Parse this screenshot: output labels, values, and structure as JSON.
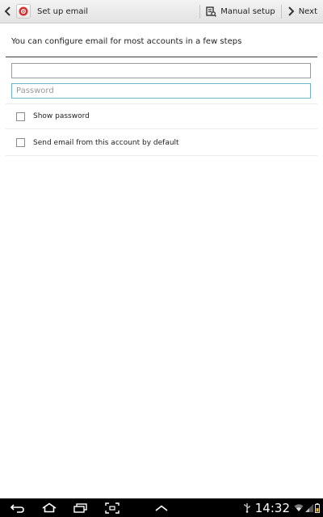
{
  "action_bar": {
    "title": "Set up email",
    "manual_setup_label": "Manual setup",
    "next_label": "Next",
    "icons": {
      "back": "chevron-left-icon",
      "app": "email-app-icon",
      "manual_setup": "manual-setup-icon",
      "next": "chevron-right-icon"
    }
  },
  "form": {
    "intro": "You can configure email for most accounts in a few steps",
    "email": {
      "value": "",
      "placeholder": ""
    },
    "password": {
      "value": "",
      "placeholder": "Password"
    },
    "options": [
      {
        "label": "Show password",
        "checked": false
      },
      {
        "label": "Send email from this account by default",
        "checked": false
      }
    ]
  },
  "system_bar": {
    "time": "14:32",
    "nav_icons": [
      "back-icon",
      "home-icon",
      "recent-apps-icon",
      "screenshot-icon",
      "menu-up-icon"
    ],
    "status_icons": [
      "usb-icon",
      "wifi-icon",
      "signal-icon",
      "battery-icon"
    ]
  },
  "colors": {
    "accent": "#6fb3c9",
    "app_icon_red": "#d42f2f",
    "system_bar": "#000000"
  }
}
